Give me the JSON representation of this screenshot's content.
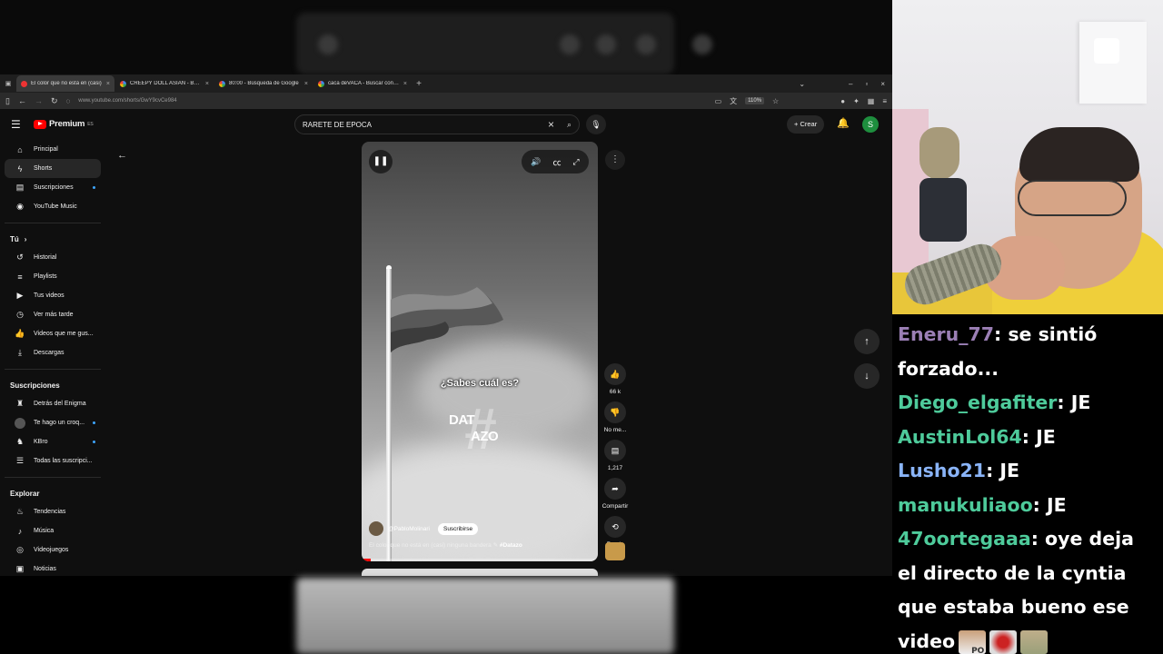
{
  "browser": {
    "tabs": [
      {
        "title": "El color que no está en (casi)",
        "active": true,
        "favicon": "youtube-icon"
      },
      {
        "title": "CREEPY DOLL ASIAN - Buscar con",
        "active": false,
        "favicon": "google-icon"
      },
      {
        "title": "80:00 - Búsqueda de Google",
        "active": false,
        "favicon": "google-icon"
      },
      {
        "title": "caca deVACA - Buscar con Goo",
        "active": false,
        "favicon": "google-icon"
      }
    ],
    "url": "www.youtube.com/shorts/GwY9cvCe984",
    "zoom": "110%"
  },
  "youtube": {
    "logo_text": "Premium",
    "logo_sup": "ES",
    "search_query": "RARETE DE EPOCA",
    "create_label": "Crear",
    "avatar_letter": "S",
    "sidebar": {
      "main": [
        {
          "label": "Principal",
          "icon": "home-icon"
        },
        {
          "label": "Shorts",
          "icon": "shorts-icon",
          "active": true
        },
        {
          "label": "Suscripciones",
          "icon": "subscriptions-icon",
          "dot": true
        },
        {
          "label": "YouTube Music",
          "icon": "music-circle-icon"
        }
      ],
      "you_header": "Tú",
      "you": [
        {
          "label": "Historial",
          "icon": "history-icon"
        },
        {
          "label": "Playlists",
          "icon": "playlists-icon"
        },
        {
          "label": "Tus videos",
          "icon": "your-videos-icon"
        },
        {
          "label": "Ver más tarde",
          "icon": "watch-later-icon"
        },
        {
          "label": "Videos que me gus...",
          "icon": "like-icon"
        },
        {
          "label": "Descargas",
          "icon": "download-icon"
        }
      ],
      "subs_header": "Suscripciones",
      "subs": [
        {
          "label": "Detrás del Enigma",
          "dot": false
        },
        {
          "label": "Te hago un croq...",
          "dot": true
        },
        {
          "label": "KBro",
          "dot": true
        },
        {
          "label": "Todas las suscripci...",
          "icon": "list-icon"
        }
      ],
      "explore_header": "Explorar",
      "explore": [
        {
          "label": "Tendencias",
          "icon": "trending-icon"
        },
        {
          "label": "Música",
          "icon": "music-icon"
        },
        {
          "label": "Videojuegos",
          "icon": "gaming-icon"
        },
        {
          "label": "Noticias",
          "icon": "news-icon"
        }
      ]
    },
    "short": {
      "overlay_question": "¿Sabes cuál es?",
      "brand_word_1": "DAT",
      "brand_word_2": "AZO",
      "channel": "@PabloMolinari",
      "subscribe_label": "Suscribirse",
      "caption": "El color que no está en (casi) ninguna bandera",
      "hashtag": "#Datazo",
      "progress": 0.04
    },
    "actions": [
      {
        "label": "66 k",
        "icon": "thumbs-up-icon"
      },
      {
        "label": "No me...",
        "icon": "thumbs-down-icon"
      },
      {
        "label": "1,217",
        "icon": "comment-icon"
      },
      {
        "label": "Compartir",
        "icon": "share-icon"
      },
      {
        "label": "Remix",
        "icon": "remix-icon"
      }
    ]
  },
  "chat": {
    "messages": [
      {
        "user": "Eneru_77",
        "color": "#9b7fb5",
        "text": "se sintió forzado..."
      },
      {
        "user": "Diego_elgafiter",
        "color": "#4ecb9b",
        "text": "JE"
      },
      {
        "user": "AustinLol64",
        "color": "#4ecb9b",
        "text": "JE"
      },
      {
        "user": "Lusho21",
        "color": "#8ab4f8",
        "text": "JE"
      },
      {
        "user": "manukuliaoo",
        "color": "#4ecb9b",
        "text": "JE"
      },
      {
        "user": "47oortegaaa",
        "color": "#4ecb9b",
        "text": "oye deja el directo de la cyntia que estaba bueno ese video"
      }
    ],
    "emote_label": "PO"
  }
}
